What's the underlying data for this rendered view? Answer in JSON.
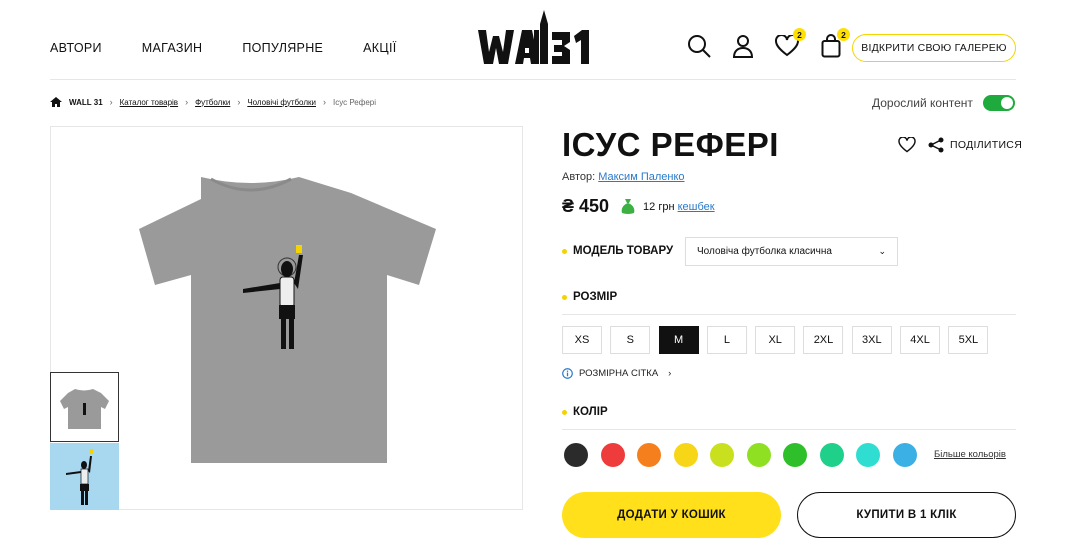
{
  "nav": {
    "items": [
      {
        "label": "АВТОРИ"
      },
      {
        "label": "МАГАЗИН"
      },
      {
        "label": "ПОПУЛЯРНЕ"
      },
      {
        "label": "АКЦІЇ"
      }
    ]
  },
  "header": {
    "logo_text": "WALL31",
    "wishlist_count": "2",
    "cart_count": "2",
    "open_gallery_label": "ВІДКРИТИ СВОЮ ГАЛЕРЕЮ"
  },
  "breadcrumb": {
    "home": "WALL 31",
    "items": [
      "Каталог товарів",
      "Футболки",
      "Чоловічі футболки"
    ],
    "current": "Ісус Рефері"
  },
  "adult_content": {
    "label": "Дорослий контент",
    "enabled": true
  },
  "product": {
    "title": "ІСУС РЕФЕРІ",
    "share_label": "ПОДІЛИТИСЯ",
    "author_prefix": "Автор:",
    "author_name": "Максим Паленко",
    "price": "₴ 450",
    "cashback_amount": "12 грн",
    "cashback_link": "кешбек",
    "model_label": "МОДЕЛЬ ТОВАРУ",
    "model_value": "Чоловіча футболка класична",
    "size_label": "РОЗМІР",
    "sizes": [
      "XS",
      "S",
      "M",
      "L",
      "XL",
      "2XL",
      "3XL",
      "4XL",
      "5XL"
    ],
    "selected_size": "M",
    "size_chart_label": "РОЗМІРНА СІТКА",
    "color_label": "КОЛІР",
    "colors": [
      "#2b2b2b",
      "#ee3b3b",
      "#f57f1c",
      "#f7d517",
      "#c9e01e",
      "#8fe022",
      "#2fbf2a",
      "#1fd08a",
      "#2fded0",
      "#3ab0e4"
    ],
    "more_colors_label": "Більше кольорів",
    "add_to_cart_label": "ДОДАТИ У КОШИК",
    "buy_one_click_label": "КУПИТИ В 1 КЛІК"
  }
}
